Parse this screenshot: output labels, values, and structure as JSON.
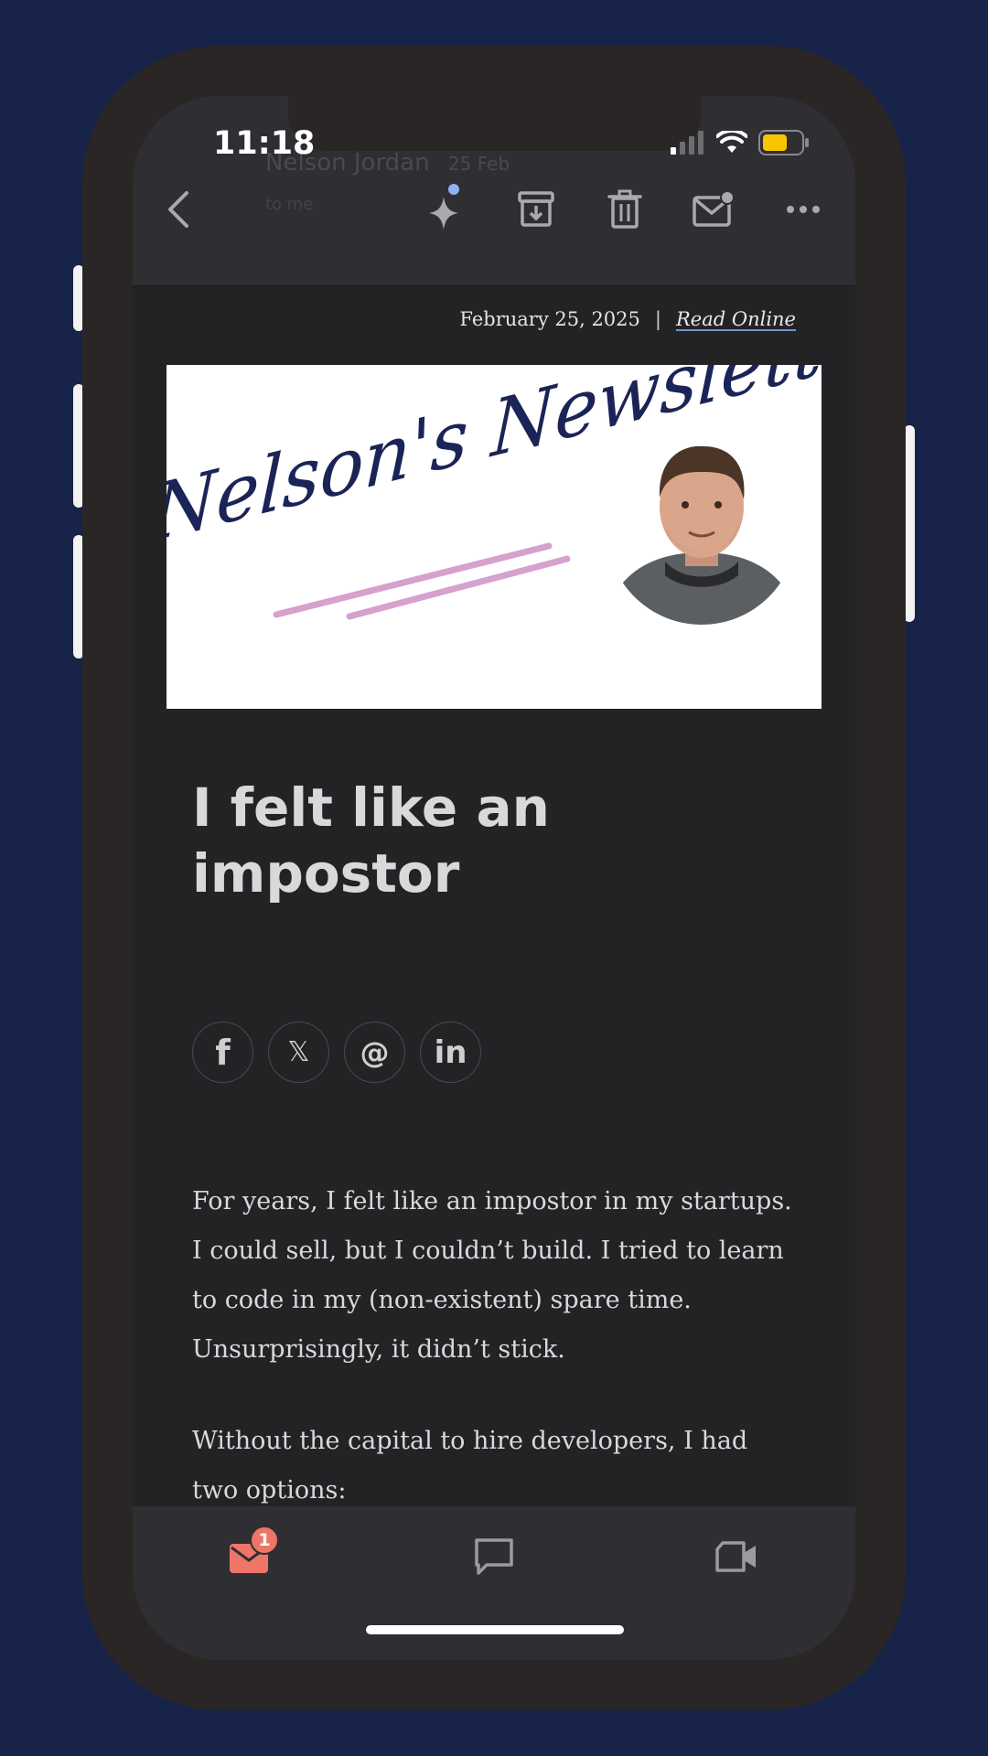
{
  "status_bar": {
    "time": "11:18"
  },
  "header_ghost": {
    "sender": "Nelson Jordan",
    "date": "25 Feb",
    "sub": "to me"
  },
  "toolbar": {
    "back_icon": "chevron-left-icon",
    "ai_icon": "sparkle-icon",
    "archive_icon": "archive-icon",
    "delete_icon": "trash-icon",
    "mark_unread_icon": "mail-unread-icon",
    "more_icon": "more-icon"
  },
  "email": {
    "date": "February 25, 2025",
    "separator": "|",
    "read_online": "Read Online",
    "banner_logo_text": "Nelson's Newsletter",
    "title": "I felt like an impostor",
    "social": [
      {
        "icon": "facebook-icon",
        "glyph": "f"
      },
      {
        "icon": "x-icon",
        "glyph": "𝕏"
      },
      {
        "icon": "threads-icon",
        "glyph": "@"
      },
      {
        "icon": "linkedin-icon",
        "glyph": "in"
      }
    ],
    "paragraphs": [
      "For years, I felt like an impostor in my startups. I could sell, but I couldn’t build. I tried to learn to code in my (non-existent) spare time.",
      "Unsurprisingly, it didn’t stick.",
      "Without the capital to hire developers, I had two options:"
    ]
  },
  "tabbar": {
    "mail_badge": "1",
    "colors": {
      "accent": "#ee7568",
      "icon": "#9a9aa0"
    }
  }
}
